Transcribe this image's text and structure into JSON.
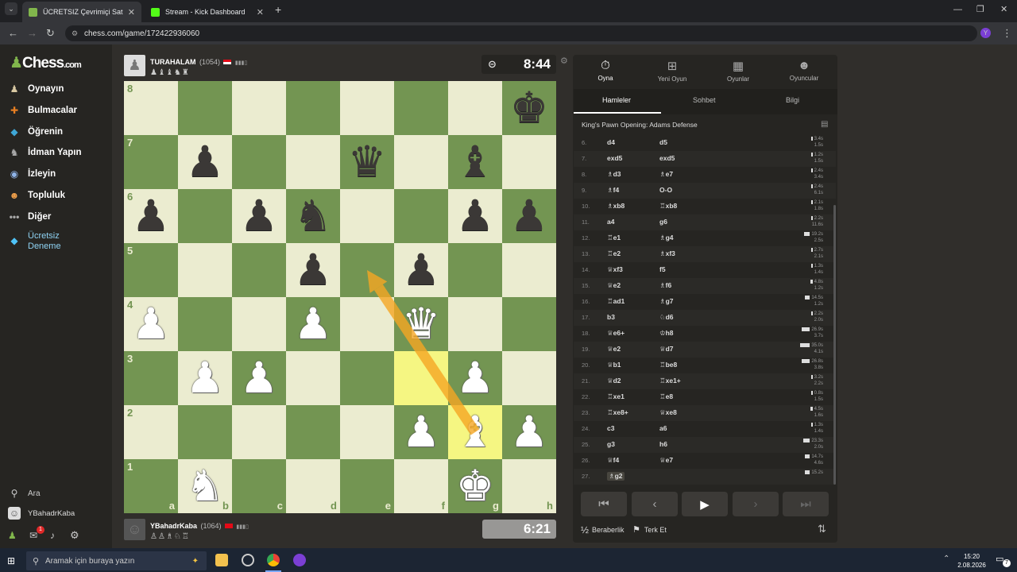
{
  "browser": {
    "tabs": [
      {
        "title": "ÜCRETSIZ Çevrimiçi Satranç Oy...",
        "active": true
      },
      {
        "title": "Stream - Kick Dashboard",
        "active": false
      }
    ],
    "url": "chess.com/game/172422936060"
  },
  "sidebar": {
    "logo": "Chess",
    "logo_suffix": ".com",
    "items": [
      "Oynayın",
      "Bulmacalar",
      "Öğrenin",
      "İdman Yapın",
      "İzleyin",
      "Topluluk",
      "Diğer"
    ],
    "trial_line1": "Ücretsiz",
    "trial_line2": "Deneme",
    "search_label": "Ara",
    "username": "YBahadrKaba",
    "notif_count": "1"
  },
  "top_player": {
    "name": "TURAHALAM",
    "rating": "(1054)",
    "captured": "♟♝♝♞♜",
    "clock": "8:44"
  },
  "bottom_player": {
    "name": "YBahadrKaba",
    "rating": "(1064)",
    "captured": "♙♙♗♘♖",
    "clock": "6:21"
  },
  "board": {
    "ranks": [
      "8",
      "7",
      "6",
      "5",
      "4",
      "3",
      "2",
      "1"
    ],
    "files": [
      "a",
      "b",
      "c",
      "d",
      "e",
      "f",
      "g",
      "h"
    ],
    "position": [
      [
        "",
        "",
        "",
        "",
        "",
        "",
        "",
        "bk"
      ],
      [
        "",
        "bp",
        "",
        "",
        "bq",
        "",
        "bb",
        ""
      ],
      [
        "bp",
        "",
        "bp",
        "bn",
        "",
        "",
        "bp",
        "bp"
      ],
      [
        "",
        "",
        "",
        "bp",
        "",
        "bp",
        "",
        ""
      ],
      [
        "wp",
        "",
        "",
        "wp",
        "",
        "wq",
        "",
        ""
      ],
      [
        "",
        "wp",
        "wp",
        "",
        "",
        "",
        "wp",
        ""
      ],
      [
        "",
        "",
        "",
        "",
        "",
        "wp",
        "wb",
        "wp"
      ],
      [
        "",
        "wn",
        "",
        "",
        "",
        "",
        "wk",
        ""
      ]
    ],
    "highlight": [
      "f3",
      "g2"
    ],
    "arrow": {
      "from": "g2",
      "to": "e5"
    }
  },
  "panel": {
    "tabs": [
      "Oyna",
      "Yeni Oyun",
      "Oyunlar",
      "Oyuncular"
    ],
    "subtabs": [
      "Hamleler",
      "Sohbet",
      "Bilgi"
    ],
    "opening": "King's Pawn Opening: Adams Defense",
    "moves": [
      {
        "n": "6.",
        "w": "d4",
        "b": "d5",
        "t1": "3.4s",
        "t2": "1.5s"
      },
      {
        "n": "7.",
        "w": "exd5",
        "b": "exd5",
        "t1": "1.2s",
        "t2": "1.5s"
      },
      {
        "n": "8.",
        "w": "♗d3",
        "b": "♗e7",
        "t1": "2.4s",
        "t2": "3.4s"
      },
      {
        "n": "9.",
        "w": "♗f4",
        "b": "O-O",
        "t1": "2.4s",
        "t2": "6.1s"
      },
      {
        "n": "10.",
        "w": "♗xb8",
        "b": "♖xb8",
        "t1": "2.1s",
        "t2": "1.8s"
      },
      {
        "n": "11.",
        "w": "a4",
        "b": "g6",
        "t1": "2.2s",
        "t2": "11.6s"
      },
      {
        "n": "12.",
        "w": "♖e1",
        "b": "♗g4",
        "t1": "19.2s",
        "t2": "2.5s"
      },
      {
        "n": "13.",
        "w": "♖e2",
        "b": "♗xf3",
        "t1": "2.7s",
        "t2": "2.1s"
      },
      {
        "n": "14.",
        "w": "♕xf3",
        "b": "f5",
        "t1": "1.3s",
        "t2": "1.4s"
      },
      {
        "n": "15.",
        "w": "♕e2",
        "b": "♗f6",
        "t1": "4.8s",
        "t2": "1.2s"
      },
      {
        "n": "16.",
        "w": "♖ad1",
        "b": "♗g7",
        "t1": "14.5s",
        "t2": "1.2s"
      },
      {
        "n": "17.",
        "w": "b3",
        "b": "♘d6",
        "t1": "2.2s",
        "t2": "2.0s"
      },
      {
        "n": "18.",
        "w": "♕e6+",
        "b": "♔h8",
        "t1": "26.9s",
        "t2": "3.7s"
      },
      {
        "n": "19.",
        "w": "♕e2",
        "b": "♕d7",
        "t1": "35.0s",
        "t2": "4.1s"
      },
      {
        "n": "20.",
        "w": "♕b1",
        "b": "♖be8",
        "t1": "26.8s",
        "t2": "3.8s"
      },
      {
        "n": "21.",
        "w": "♕d2",
        "b": "♖xe1+",
        "t1": "3.2s",
        "t2": "2.2s"
      },
      {
        "n": "22.",
        "w": "♖xe1",
        "b": "♖e8",
        "t1": "0.8s",
        "t2": "1.5s"
      },
      {
        "n": "23.",
        "w": "♖xe8+",
        "b": "♕xe8",
        "t1": "4.5s",
        "t2": "1.6s"
      },
      {
        "n": "24.",
        "w": "c3",
        "b": "a6",
        "t1": "1.3s",
        "t2": "1.4s"
      },
      {
        "n": "25.",
        "w": "g3",
        "b": "h6",
        "t1": "23.3s",
        "t2": "2.0s"
      },
      {
        "n": "26.",
        "w": "♕f4",
        "b": "♕e7",
        "t1": "14.7s",
        "t2": "4.6s"
      },
      {
        "n": "27.",
        "w": "♗g2",
        "b": "",
        "t1": "15.2s",
        "t2": ""
      }
    ],
    "draw_label": "Beraberlik",
    "resign_label": "Terk Et",
    "draw_icon": "½"
  },
  "taskbar": {
    "search_placeholder": "Aramak için buraya yazın",
    "time": "15:20",
    "date": "2.08.2026",
    "notif": "7"
  },
  "colors": {
    "light": "#ebecd0",
    "dark": "#739552",
    "highlight": "#f5f682",
    "arrow": "#f5a623"
  }
}
